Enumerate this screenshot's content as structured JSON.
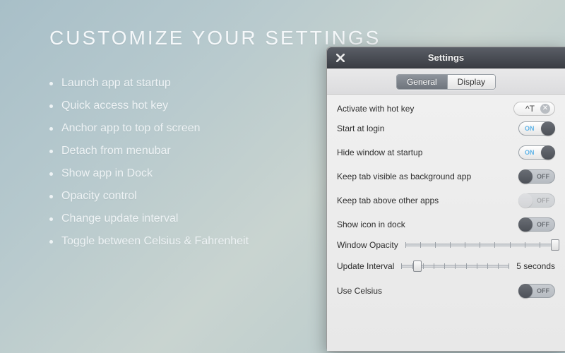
{
  "heading": "CUSTOMIZE YOUR SETTINGS",
  "features": [
    "Launch app at startup",
    "Quick access hot key",
    "Anchor app to top of screen",
    "Detach from menubar",
    "Show app in Dock",
    "Opacity control",
    "Change update interval",
    "Toggle between Celsius & Fahrenheit"
  ],
  "panel": {
    "title": "Settings",
    "tabs": {
      "general": "General",
      "display": "Display"
    },
    "rows": {
      "hotkey_label": "Activate with hot key",
      "hotkey_value": "^T",
      "start_login": "Start at login",
      "hide_startup": "Hide window at startup",
      "bg_app": "Keep tab visible as background app",
      "above_apps": "Keep tab above other apps",
      "dock_icon": "Show icon in dock",
      "opacity": "Window Opacity",
      "interval": "Update Interval",
      "interval_value": "5 seconds",
      "celsius": "Use Celsius"
    },
    "toggle_text": {
      "on": "ON",
      "off": "OFF"
    },
    "values": {
      "start_login": true,
      "hide_startup": true,
      "bg_app": false,
      "above_apps": false,
      "dock_icon": false,
      "celsius": false,
      "opacity_percent": 100,
      "interval_percent": 15
    }
  }
}
